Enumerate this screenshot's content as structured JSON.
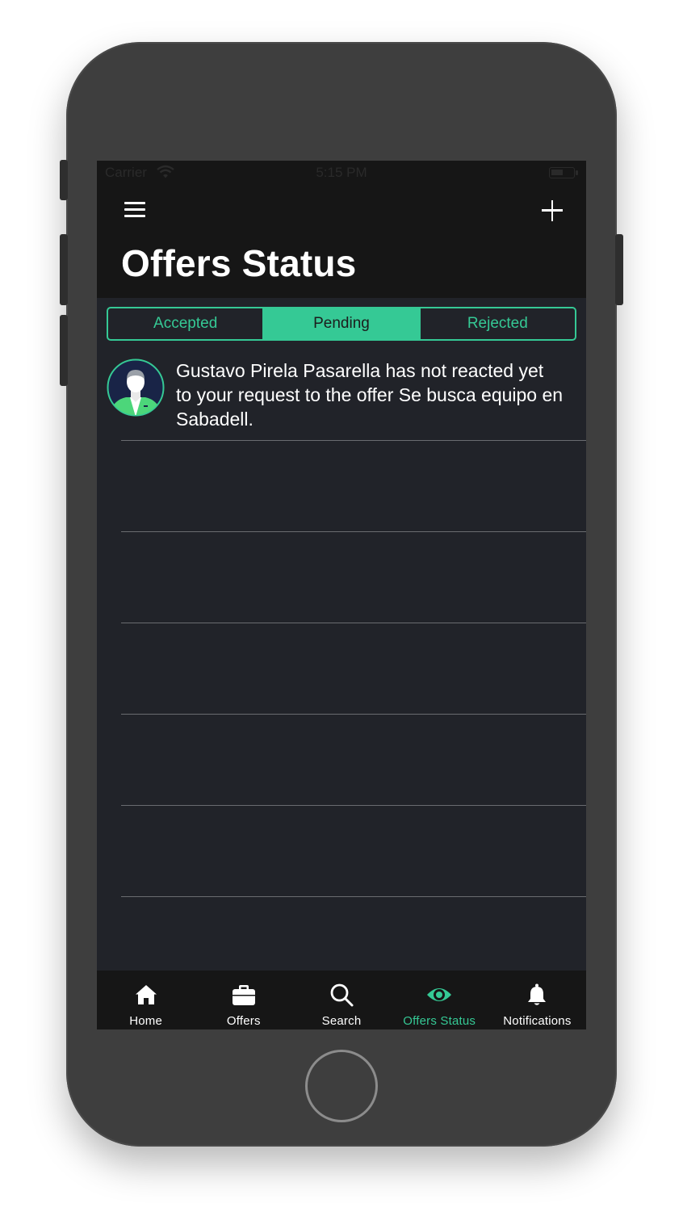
{
  "status_bar": {
    "carrier": "Carrier",
    "time": "5:15 PM"
  },
  "header": {
    "title": "Offers Status",
    "menu_icon": "hamburger-menu-icon",
    "add_icon": "plus-icon"
  },
  "segments": [
    {
      "label": "Accepted",
      "active": false
    },
    {
      "label": "Pending",
      "active": true
    },
    {
      "label": "Rejected",
      "active": false
    }
  ],
  "list": {
    "items": [
      {
        "avatar_icon": "player-avatar-icon",
        "text": "Gustavo Pirela Pasarella has not reacted yet to your request to the offer Se busca equipo en Sabadell."
      }
    ]
  },
  "tabbar": {
    "items": [
      {
        "label": "Home",
        "icon": "home-icon",
        "active": false
      },
      {
        "label": "Offers",
        "icon": "briefcase-icon",
        "active": false
      },
      {
        "label": "Search",
        "icon": "search-icon",
        "active": false
      },
      {
        "label": "Offers Status",
        "icon": "eye-icon",
        "active": true
      },
      {
        "label": "Notifications",
        "icon": "bell-icon",
        "active": false
      }
    ]
  },
  "colors": {
    "accent": "#35c995",
    "background": "#212329",
    "bars": "#161616"
  }
}
